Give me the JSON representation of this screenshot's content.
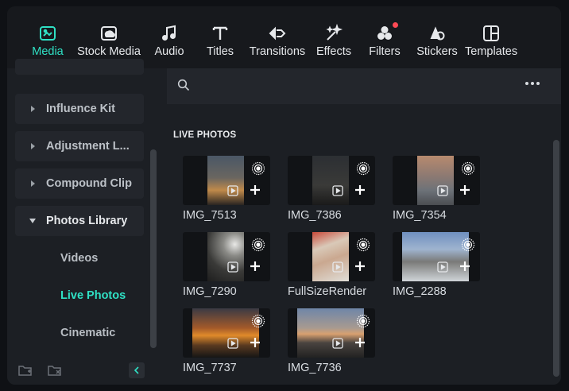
{
  "toolbar": {
    "tabs": [
      {
        "label": "Media",
        "icon": "media-icon",
        "active": true
      },
      {
        "label": "Stock Media",
        "icon": "stock-media-icon"
      },
      {
        "label": "Audio",
        "icon": "music-note-icon"
      },
      {
        "label": "Titles",
        "icon": "text-t-icon"
      },
      {
        "label": "Transitions",
        "icon": "transition-arrows-icon"
      },
      {
        "label": "Effects",
        "icon": "sparkle-wand-icon"
      },
      {
        "label": "Filters",
        "icon": "filter-circles-icon",
        "notification": true
      },
      {
        "label": "Stickers",
        "icon": "sticker-icon"
      },
      {
        "label": "Templates",
        "icon": "template-grid-icon"
      }
    ],
    "accent_color": "#2fe0c4",
    "notification_color": "#ff4a55"
  },
  "sidebar": {
    "items": [
      {
        "label": "Influence Kit",
        "expanded": false
      },
      {
        "label": "Adjustment L...",
        "expanded": false
      },
      {
        "label": "Compound Clip",
        "expanded": false
      },
      {
        "label": "Photos Library",
        "expanded": true
      }
    ],
    "subitems": [
      {
        "label": "Videos",
        "active": false
      },
      {
        "label": "Live Photos",
        "active": true
      },
      {
        "label": "Cinematic",
        "active": false
      }
    ],
    "footer_icons": [
      "new-folder-icon",
      "remove-folder-icon",
      "collapse-panel-icon"
    ]
  },
  "main": {
    "search": {
      "placeholder": ""
    },
    "section_title": "LIVE PHOTOS",
    "items": [
      {
        "name": "IMG_7513"
      },
      {
        "name": "IMG_7386"
      },
      {
        "name": "IMG_7354"
      },
      {
        "name": "IMG_7290"
      },
      {
        "name": "FullSizeRender"
      },
      {
        "name": "IMG_2288"
      },
      {
        "name": "IMG_7737"
      },
      {
        "name": "IMG_7736"
      }
    ]
  }
}
